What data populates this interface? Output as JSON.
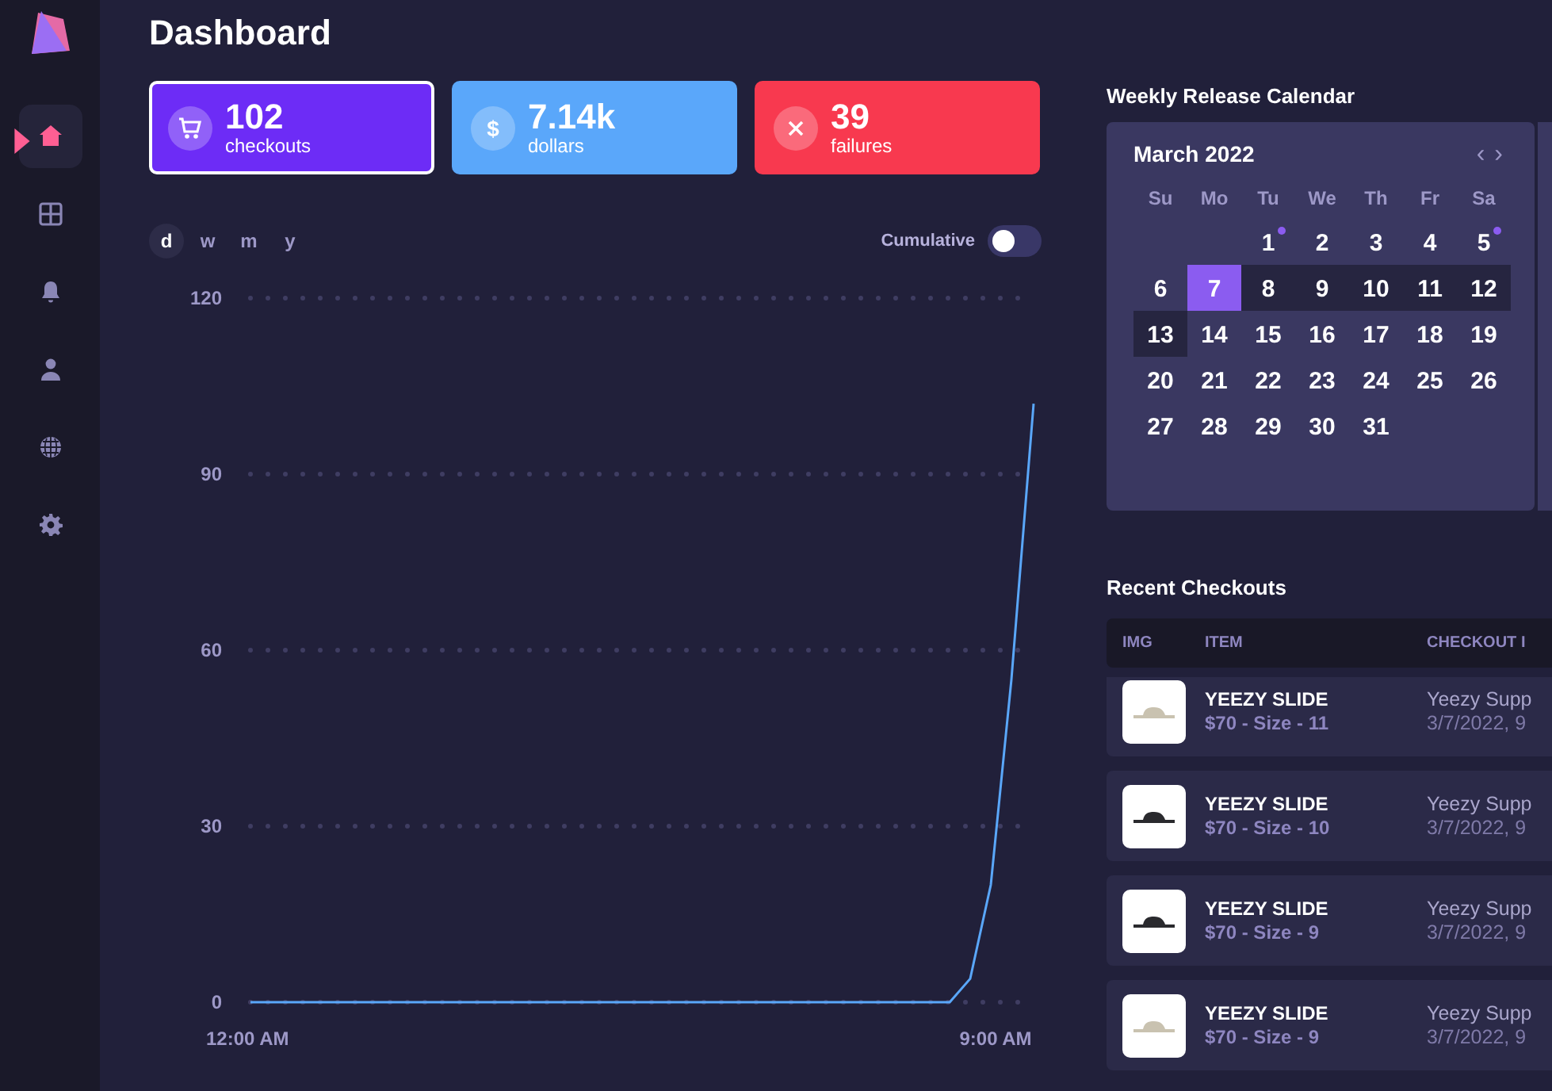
{
  "sidebar": {
    "items": [
      {
        "kind": "home",
        "selected": true
      },
      {
        "kind": "grid",
        "selected": false
      },
      {
        "kind": "bell",
        "selected": false
      },
      {
        "kind": "user",
        "selected": false
      },
      {
        "kind": "globe",
        "selected": false
      },
      {
        "kind": "gear",
        "selected": false
      }
    ]
  },
  "title": "Dashboard",
  "stats": [
    {
      "kind": "cart",
      "value": "102",
      "label": "checkouts",
      "color": "#6d2cf6",
      "selected": true
    },
    {
      "kind": "dollar",
      "symbol": "$",
      "value": "7.14k",
      "label": "dollars",
      "color": "#5aa7fa",
      "selected": false
    },
    {
      "kind": "cross",
      "value": "39",
      "label": "failures",
      "color": "#f8394f",
      "selected": false
    }
  ],
  "ranges": [
    {
      "label": "d",
      "selected": true
    },
    {
      "label": "w",
      "selected": false
    },
    {
      "label": "m",
      "selected": false
    },
    {
      "label": "y",
      "selected": false
    }
  ],
  "cumulative": {
    "label": "Cumulative",
    "on": false
  },
  "chart": {
    "chart_data": {
      "type": "line",
      "x": [
        0,
        1,
        2,
        3,
        4,
        5,
        6,
        7,
        8,
        8.5,
        8.75,
        9,
        9.25,
        9.52
      ],
      "grid": true,
      "series": [
        {
          "color": "#5aa7fa",
          "values": [
            0,
            0,
            0,
            0,
            0,
            0,
            0,
            0,
            0,
            0,
            4,
            20,
            55,
            102
          ]
        }
      ],
      "xlim": [
        0,
        9.52
      ],
      "ylim": [
        0,
        120
      ],
      "xticks": [
        {
          "value": 0,
          "label": "12:00 AM"
        },
        {
          "value": 9,
          "label": "9:00 AM"
        }
      ],
      "yticks": [
        0,
        30,
        60,
        90,
        120
      ]
    }
  },
  "calendar": {
    "title": "Weekly Release Calendar",
    "month": "March 2022",
    "prev": "‹",
    "next": "›",
    "weekdays": [
      "Su",
      "Mo",
      "Tu",
      "We",
      "Th",
      "Fr",
      "Sa"
    ],
    "weeks": [
      [
        {
          "kind": "blank"
        },
        {
          "kind": "blank"
        },
        {
          "kind": "day",
          "label": "1",
          "selected": false,
          "in_week": false,
          "release": true
        },
        {
          "kind": "day",
          "label": "2",
          "selected": false,
          "in_week": false,
          "release": false
        },
        {
          "kind": "day",
          "label": "3",
          "selected": false,
          "in_week": false,
          "release": false
        },
        {
          "kind": "day",
          "label": "4",
          "selected": false,
          "in_week": false,
          "release": false
        },
        {
          "kind": "day",
          "label": "5",
          "selected": false,
          "in_week": false,
          "release": true
        }
      ],
      [
        {
          "kind": "day",
          "label": "6",
          "selected": false,
          "in_week": false,
          "release": false
        },
        {
          "kind": "day",
          "label": "7",
          "selected": true,
          "in_week": true,
          "release": false
        },
        {
          "kind": "day",
          "label": "8",
          "selected": false,
          "in_week": true,
          "release": false
        },
        {
          "kind": "day",
          "label": "9",
          "selected": false,
          "in_week": true,
          "release": false
        },
        {
          "kind": "day",
          "label": "10",
          "selected": false,
          "in_week": true,
          "release": false
        },
        {
          "kind": "day",
          "label": "11",
          "selected": false,
          "in_week": true,
          "release": false
        },
        {
          "kind": "day",
          "label": "12",
          "selected": false,
          "in_week": true,
          "release": false
        }
      ],
      [
        {
          "kind": "day",
          "label": "13",
          "selected": false,
          "in_week": true,
          "release": false
        },
        {
          "kind": "day",
          "label": "14",
          "selected": false,
          "in_week": false,
          "release": false
        },
        {
          "kind": "day",
          "label": "15",
          "selected": false,
          "in_week": false,
          "release": false
        },
        {
          "kind": "day",
          "label": "16",
          "selected": false,
          "in_week": false,
          "release": false
        },
        {
          "kind": "day",
          "label": "17",
          "selected": false,
          "in_week": false,
          "release": false
        },
        {
          "kind": "day",
          "label": "18",
          "selected": false,
          "in_week": false,
          "release": false
        },
        {
          "kind": "day",
          "label": "19",
          "selected": false,
          "in_week": false,
          "release": false
        }
      ],
      [
        {
          "kind": "day",
          "label": "20",
          "selected": false,
          "in_week": false,
          "release": false
        },
        {
          "kind": "day",
          "label": "21",
          "selected": false,
          "in_week": false,
          "release": false
        },
        {
          "kind": "day",
          "label": "22",
          "selected": false,
          "in_week": false,
          "release": false
        },
        {
          "kind": "day",
          "label": "23",
          "selected": false,
          "in_week": false,
          "release": false
        },
        {
          "kind": "day",
          "label": "24",
          "selected": false,
          "in_week": false,
          "release": false
        },
        {
          "kind": "day",
          "label": "25",
          "selected": false,
          "in_week": false,
          "release": false
        },
        {
          "kind": "day",
          "label": "26",
          "selected": false,
          "in_week": false,
          "release": false
        }
      ],
      [
        {
          "kind": "day",
          "label": "27",
          "selected": false,
          "in_week": false,
          "release": false
        },
        {
          "kind": "day",
          "label": "28",
          "selected": false,
          "in_week": false,
          "release": false
        },
        {
          "kind": "day",
          "label": "29",
          "selected": false,
          "in_week": false,
          "release": false
        },
        {
          "kind": "day",
          "label": "30",
          "selected": false,
          "in_week": false,
          "release": false
        },
        {
          "kind": "day",
          "label": "31",
          "selected": false,
          "in_week": false,
          "release": false
        }
      ]
    ]
  },
  "checkouts": {
    "title": "Recent Checkouts",
    "columns": [
      "IMG",
      "ITEM",
      "CHECKOUT I"
    ],
    "rows": [
      {
        "image": {
          "color": "#c9c2b0"
        },
        "item": "YEEZY SLIDE",
        "detail": "$70 - Size - 11",
        "site": "Yeezy Supp",
        "time": "3/7/2022, 9"
      },
      {
        "image": {
          "color": "#2a2a2e"
        },
        "item": "YEEZY SLIDE",
        "detail": "$70 - Size - 10",
        "site": "Yeezy Supp",
        "time": "3/7/2022, 9"
      },
      {
        "image": {
          "color": "#2a2a2e"
        },
        "item": "YEEZY SLIDE",
        "detail": "$70 - Size - 9",
        "site": "Yeezy Supp",
        "time": "3/7/2022, 9"
      },
      {
        "image": {
          "color": "#c9c2b0"
        },
        "item": "YEEZY SLIDE",
        "detail": "$70 - Size - 9",
        "site": "Yeezy Supp",
        "time": "3/7/2022, 9"
      }
    ]
  }
}
